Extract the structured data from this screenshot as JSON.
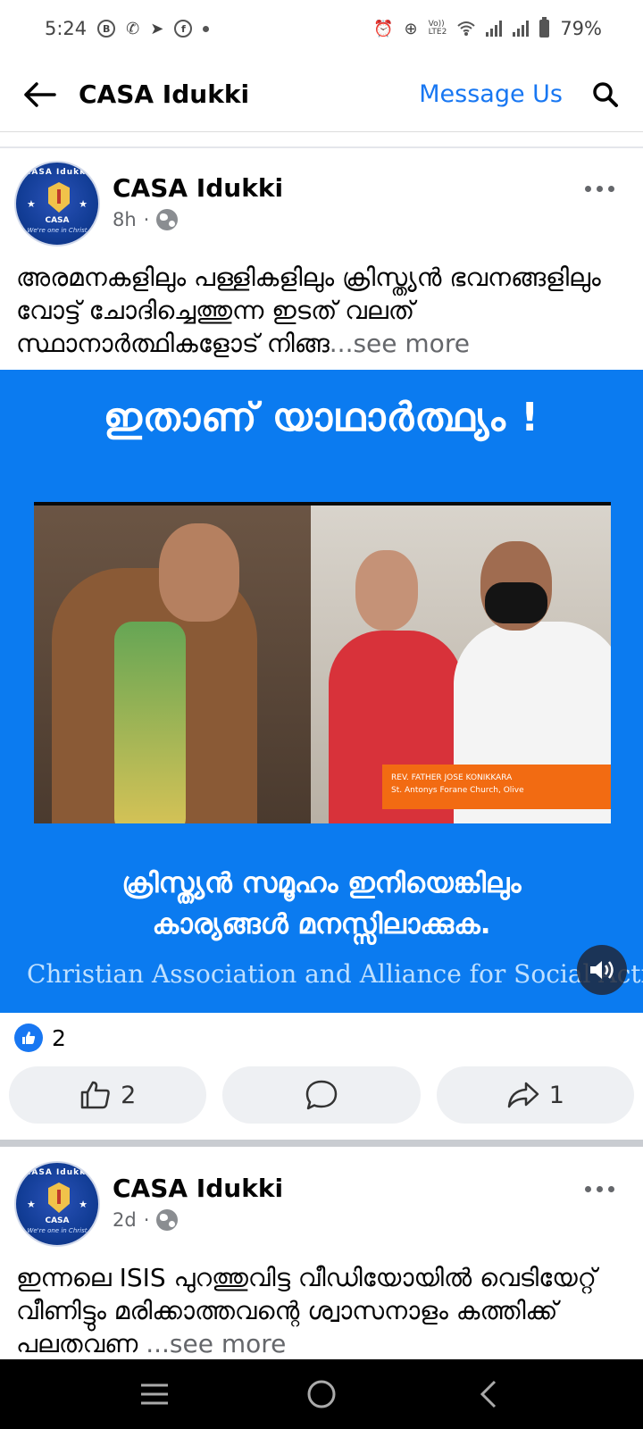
{
  "status_bar": {
    "time": "5:24",
    "left_icons": [
      "b-icon",
      "whatsapp-icon",
      "telegram-icon",
      "facebook-icon",
      "dot-icon"
    ],
    "right_icons": [
      "alarm-icon",
      "data-saver-icon",
      "volte-icon",
      "wifi-icon",
      "signal-icon",
      "signal-icon",
      "battery-icon"
    ],
    "volte_text": "Vo))\nLTE2",
    "battery": "79%"
  },
  "header": {
    "title": "CASA Idukki",
    "message_label": "Message Us"
  },
  "posts": [
    {
      "page_name": "CASA Idukki",
      "time": "8h",
      "separator": "·",
      "text": "അരമനകളിലും പള്ളികളിലും  ക്രിസ്ത്യൻ ഭവനങ്ങളിലും വോട്ട് ചോദിച്ചെത്തുന്ന ഇടത് വലത് സ്ഥാനാർത്ഥികളോട് നിങ്ങ",
      "see_more": "...see more",
      "image": {
        "headline": "ഇതാണ് യാഥാർത്ഥ്യം !",
        "caption_line1": "REV. FATHER JOSE KONIKKARA",
        "caption_line2": "St. Antonys Forane Church, Olive",
        "subtitle_line1": "ക്രിസ്ത്യൻ സമൂഹം ഇനിയെങ്കിലും",
        "subtitle_line2": "കാര്യങ്ങൾ മനസ്സിലാക്കുക.",
        "footer": "Christian Association and Alliance for Social Action"
      },
      "reaction_count": "2",
      "like_count": "2",
      "share_count": "1"
    },
    {
      "page_name": "CASA Idukki",
      "time": "2d",
      "separator": "·",
      "text": "ഇന്നലെ ISIS പുറത്തുവിട്ട വീഡിയോയിൽ വെടിയേറ്റ് വീണിട്ടും മരിക്കാത്തവന്റെ ശ്വാസനാളം കത്തിക്ക് പലതവണ ",
      "see_more": "...see more"
    }
  ],
  "avatar": {
    "ring_text": "CASA Idukki",
    "label": "CASA",
    "motto": "We're one in Christ"
  },
  "colors": {
    "accent": "#1877f2",
    "image_bg": "#0b7bf0",
    "caption_orange": "#f26b12"
  }
}
